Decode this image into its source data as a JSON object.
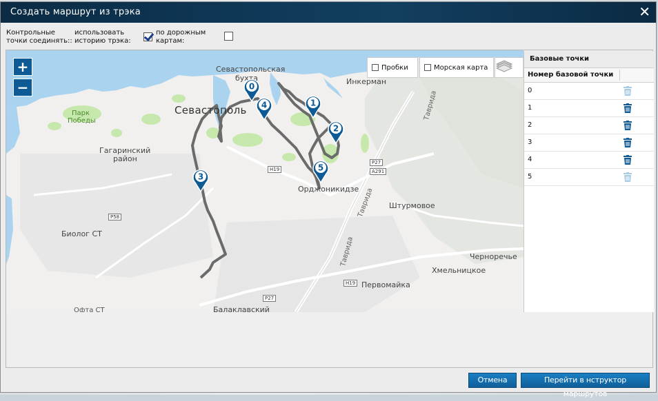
{
  "dialog": {
    "title": "Создать маршрут из трэка",
    "close_glyph": "✕"
  },
  "options": {
    "connect_label_1": "Контрольные",
    "connect_label_2": "точки соединять::",
    "history_label_1": "использовать",
    "history_label_2": "историю трэка:",
    "history_checked": true,
    "road_label_1": "по дорожным",
    "road_label_2": "картам:",
    "road_checked": false
  },
  "map": {
    "zoom_in": "+",
    "zoom_out": "−",
    "traffic_label": "Пробки",
    "sea_label": "Морская карта",
    "layers_icon": "layers-icon",
    "labels": {
      "city": "Севастополь",
      "bay": "Севастопольская",
      "bay2": "бухта",
      "park1": "Парк",
      "park2": "Победы",
      "gagarin1": "Гагаринский",
      "gagarin2": "район",
      "biolog": "Биолог СТ",
      "inkerman": "Инкерман",
      "ordzh": "Орджоникидзе",
      "shturm": "Штурмовое",
      "tavrida1": "Таврида",
      "tavrida2": "Таврида",
      "tavrida3": "Таврида",
      "chernor": "Черноречье",
      "hmel": "Хмельницкое",
      "pervom": "Первомайка",
      "balakl": "Балаклавский",
      "ofta": "Офта СТ",
      "p27a": "P27",
      "p27b": "P27",
      "h19a": "H19",
      "h19b": "H19",
      "a291": "A291",
      "p58": "P58"
    },
    "markers": [
      "0",
      "1",
      "2",
      "3",
      "4",
      "5"
    ]
  },
  "panel": {
    "title": "Базовые точки",
    "column": "Номер базовой точки",
    "rows": [
      {
        "label": "0",
        "icon": "trash-icon",
        "enabled": false
      },
      {
        "label": "1",
        "icon": "trash-icon",
        "enabled": true
      },
      {
        "label": "2",
        "icon": "trash-icon",
        "enabled": true
      },
      {
        "label": "3",
        "icon": "trash-icon",
        "enabled": true
      },
      {
        "label": "4",
        "icon": "trash-icon",
        "enabled": true
      },
      {
        "label": "5",
        "icon": "trash-icon",
        "enabled": false
      }
    ]
  },
  "footer": {
    "cancel": "Отмена",
    "go": "Перейти в нструктор маршрутов"
  },
  "colors": {
    "title_bg": "#0f3a5a",
    "accent": "#0d5a95",
    "track": "#6b6b6b",
    "water": "#aad3f0",
    "park": "#b9e39a"
  }
}
